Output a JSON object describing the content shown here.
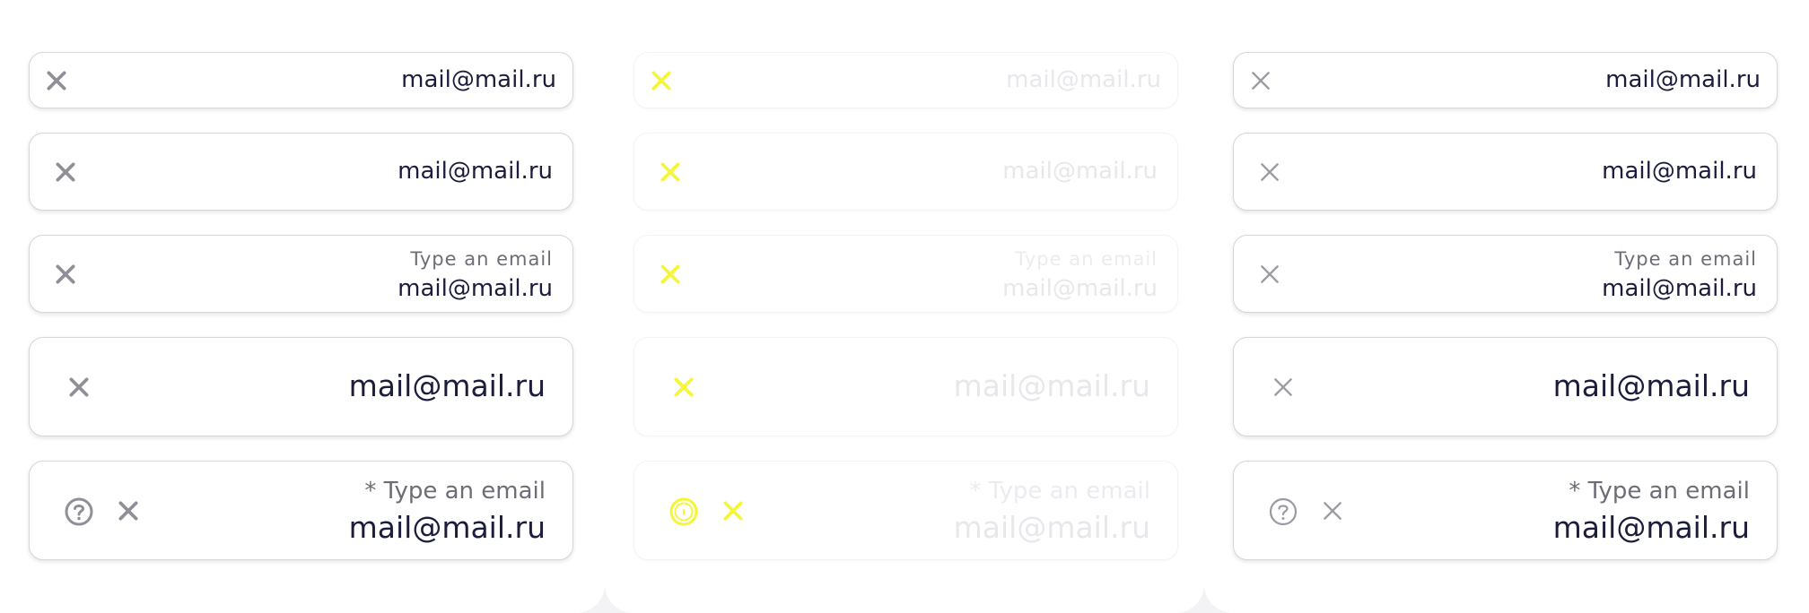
{
  "colors": {
    "value_text": "#1c1c3c",
    "label_text": "#6d6d78",
    "icon_dark": "#8f8f99",
    "icon_light": "#9a9aa3",
    "disabled_text": "#e8e8ec",
    "highlight_icon": "#f5f53a",
    "border": "#d6d6db"
  },
  "icons": {
    "clear": "close-icon",
    "help": "question-circle-icon"
  },
  "panels": [
    {
      "state": "filled",
      "rows": [
        {
          "value": "mail@mail.ru"
        },
        {
          "value": "mail@mail.ru"
        },
        {
          "label": "Type an email",
          "value": "mail@mail.ru"
        },
        {
          "value": "mail@mail.ru"
        },
        {
          "label": "* Type an email",
          "value": "mail@mail.ru"
        }
      ]
    },
    {
      "state": "disabled",
      "rows": [
        {
          "value": "mail@mail.ru"
        },
        {
          "value": "mail@mail.ru"
        },
        {
          "label": "Type an email",
          "value": "mail@mail.ru"
        },
        {
          "value": "mail@mail.ru"
        },
        {
          "label": "* Type an email",
          "value": "mail@mail.ru"
        }
      ]
    },
    {
      "state": "filled-light-icons",
      "rows": [
        {
          "value": "mail@mail.ru"
        },
        {
          "value": "mail@mail.ru"
        },
        {
          "label": "Type an email",
          "value": "mail@mail.ru"
        },
        {
          "value": "mail@mail.ru"
        },
        {
          "label": "* Type an email",
          "value": "mail@mail.ru"
        }
      ]
    }
  ]
}
